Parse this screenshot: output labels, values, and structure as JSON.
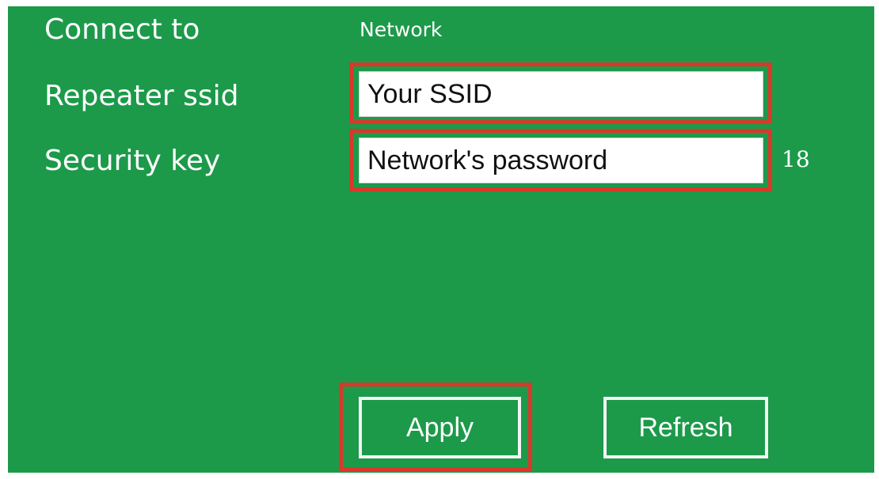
{
  "form": {
    "connect_to_label": "Connect to",
    "connect_to_value": "Network",
    "repeater_ssid_label": "Repeater ssid",
    "repeater_ssid_value": "Your SSID",
    "security_key_label": "Security key",
    "security_key_value": "Network's password",
    "security_key_length": "18"
  },
  "actions": {
    "apply_label": "Apply",
    "refresh_label": "Refresh"
  },
  "colors": {
    "background": "#1c9a4a",
    "highlight": "#d9382a",
    "text": "#ffffff"
  }
}
